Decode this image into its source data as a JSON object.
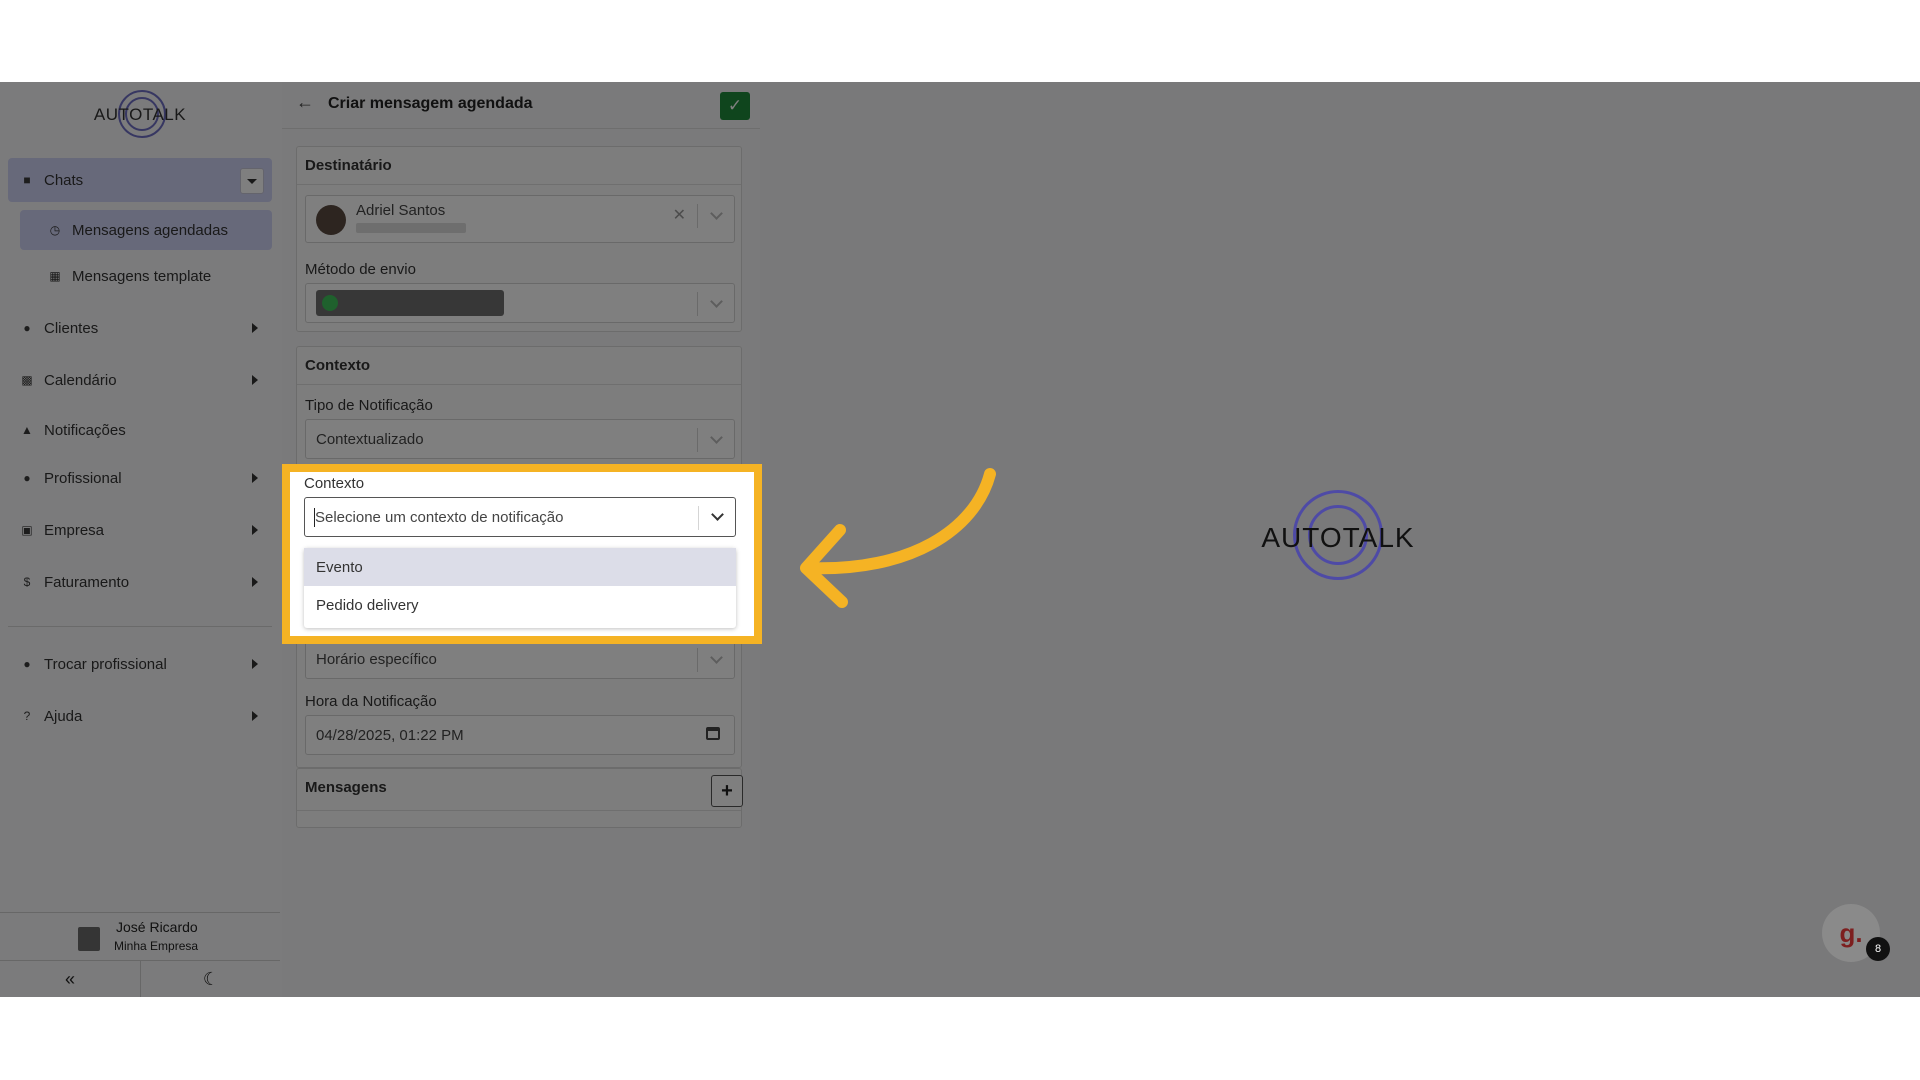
{
  "sidebar": {
    "brand": "AUTOTALK",
    "items": [
      {
        "label": "Chats"
      },
      {
        "label": "Mensagens agendadas"
      },
      {
        "label": "Mensagens template"
      },
      {
        "label": "Clientes"
      },
      {
        "label": "Calendário"
      },
      {
        "label": "Notificações"
      },
      {
        "label": "Profissional"
      },
      {
        "label": "Empresa"
      },
      {
        "label": "Faturamento"
      },
      {
        "label": "Trocar profissional"
      },
      {
        "label": "Ajuda"
      }
    ],
    "user": {
      "name": "José Ricardo",
      "company": "Minha Empresa"
    }
  },
  "form": {
    "title": "Criar mensagem agendada",
    "destinatario": {
      "section": "Destinatário",
      "contact_name": "Adriel Santos",
      "method_label": "Método de envio"
    },
    "contexto": {
      "section": "Contexto",
      "tipo_label": "Tipo de Notificação",
      "tipo_value": "Contextualizado",
      "contexto_label": "Contexto",
      "contexto_placeholder": "Selecione um contexto de notificação",
      "options": [
        "Evento",
        "Pedido delivery"
      ],
      "horario_value": "Horário específico",
      "hora_label": "Hora da Notificação",
      "hora_value": "04/28/2025, 01:22 PM"
    },
    "mensagens": {
      "section": "Mensagens"
    }
  },
  "preview": {
    "brand": "AUTOTALK"
  },
  "chat_widget": {
    "glyph": "g.",
    "badge": "8"
  },
  "icons": {
    "back": "arrow-left-icon",
    "confirm": "check-icon",
    "calendar": "calendar-icon",
    "add": "plus-icon",
    "collapse": "double-chevron-left-icon",
    "theme": "moon-icon"
  },
  "colors": {
    "highlight": "#f5b324",
    "accent": "#cfd2f5",
    "confirm": "#1f8a3a"
  }
}
